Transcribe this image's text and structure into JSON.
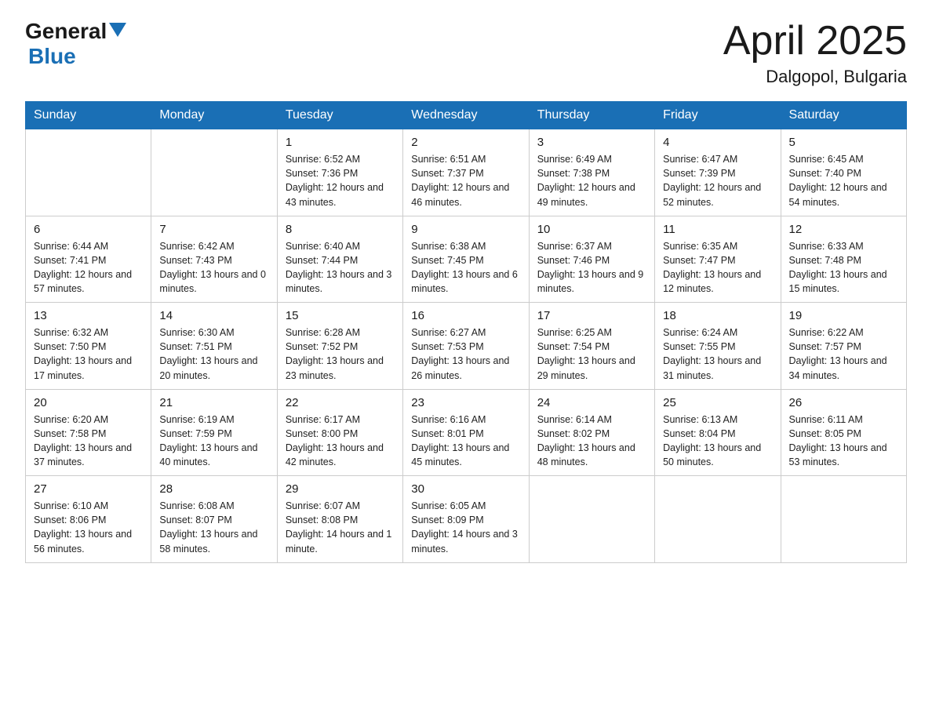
{
  "header": {
    "logo_general": "General",
    "logo_blue": "Blue",
    "title": "April 2025",
    "subtitle": "Dalgopol, Bulgaria"
  },
  "days_of_week": [
    "Sunday",
    "Monday",
    "Tuesday",
    "Wednesday",
    "Thursday",
    "Friday",
    "Saturday"
  ],
  "weeks": [
    [
      {
        "day": "",
        "sunrise": "",
        "sunset": "",
        "daylight": ""
      },
      {
        "day": "",
        "sunrise": "",
        "sunset": "",
        "daylight": ""
      },
      {
        "day": "1",
        "sunrise": "Sunrise: 6:52 AM",
        "sunset": "Sunset: 7:36 PM",
        "daylight": "Daylight: 12 hours and 43 minutes."
      },
      {
        "day": "2",
        "sunrise": "Sunrise: 6:51 AM",
        "sunset": "Sunset: 7:37 PM",
        "daylight": "Daylight: 12 hours and 46 minutes."
      },
      {
        "day": "3",
        "sunrise": "Sunrise: 6:49 AM",
        "sunset": "Sunset: 7:38 PM",
        "daylight": "Daylight: 12 hours and 49 minutes."
      },
      {
        "day": "4",
        "sunrise": "Sunrise: 6:47 AM",
        "sunset": "Sunset: 7:39 PM",
        "daylight": "Daylight: 12 hours and 52 minutes."
      },
      {
        "day": "5",
        "sunrise": "Sunrise: 6:45 AM",
        "sunset": "Sunset: 7:40 PM",
        "daylight": "Daylight: 12 hours and 54 minutes."
      }
    ],
    [
      {
        "day": "6",
        "sunrise": "Sunrise: 6:44 AM",
        "sunset": "Sunset: 7:41 PM",
        "daylight": "Daylight: 12 hours and 57 minutes."
      },
      {
        "day": "7",
        "sunrise": "Sunrise: 6:42 AM",
        "sunset": "Sunset: 7:43 PM",
        "daylight": "Daylight: 13 hours and 0 minutes."
      },
      {
        "day": "8",
        "sunrise": "Sunrise: 6:40 AM",
        "sunset": "Sunset: 7:44 PM",
        "daylight": "Daylight: 13 hours and 3 minutes."
      },
      {
        "day": "9",
        "sunrise": "Sunrise: 6:38 AM",
        "sunset": "Sunset: 7:45 PM",
        "daylight": "Daylight: 13 hours and 6 minutes."
      },
      {
        "day": "10",
        "sunrise": "Sunrise: 6:37 AM",
        "sunset": "Sunset: 7:46 PM",
        "daylight": "Daylight: 13 hours and 9 minutes."
      },
      {
        "day": "11",
        "sunrise": "Sunrise: 6:35 AM",
        "sunset": "Sunset: 7:47 PM",
        "daylight": "Daylight: 13 hours and 12 minutes."
      },
      {
        "day": "12",
        "sunrise": "Sunrise: 6:33 AM",
        "sunset": "Sunset: 7:48 PM",
        "daylight": "Daylight: 13 hours and 15 minutes."
      }
    ],
    [
      {
        "day": "13",
        "sunrise": "Sunrise: 6:32 AM",
        "sunset": "Sunset: 7:50 PM",
        "daylight": "Daylight: 13 hours and 17 minutes."
      },
      {
        "day": "14",
        "sunrise": "Sunrise: 6:30 AM",
        "sunset": "Sunset: 7:51 PM",
        "daylight": "Daylight: 13 hours and 20 minutes."
      },
      {
        "day": "15",
        "sunrise": "Sunrise: 6:28 AM",
        "sunset": "Sunset: 7:52 PM",
        "daylight": "Daylight: 13 hours and 23 minutes."
      },
      {
        "day": "16",
        "sunrise": "Sunrise: 6:27 AM",
        "sunset": "Sunset: 7:53 PM",
        "daylight": "Daylight: 13 hours and 26 minutes."
      },
      {
        "day": "17",
        "sunrise": "Sunrise: 6:25 AM",
        "sunset": "Sunset: 7:54 PM",
        "daylight": "Daylight: 13 hours and 29 minutes."
      },
      {
        "day": "18",
        "sunrise": "Sunrise: 6:24 AM",
        "sunset": "Sunset: 7:55 PM",
        "daylight": "Daylight: 13 hours and 31 minutes."
      },
      {
        "day": "19",
        "sunrise": "Sunrise: 6:22 AM",
        "sunset": "Sunset: 7:57 PM",
        "daylight": "Daylight: 13 hours and 34 minutes."
      }
    ],
    [
      {
        "day": "20",
        "sunrise": "Sunrise: 6:20 AM",
        "sunset": "Sunset: 7:58 PM",
        "daylight": "Daylight: 13 hours and 37 minutes."
      },
      {
        "day": "21",
        "sunrise": "Sunrise: 6:19 AM",
        "sunset": "Sunset: 7:59 PM",
        "daylight": "Daylight: 13 hours and 40 minutes."
      },
      {
        "day": "22",
        "sunrise": "Sunrise: 6:17 AM",
        "sunset": "Sunset: 8:00 PM",
        "daylight": "Daylight: 13 hours and 42 minutes."
      },
      {
        "day": "23",
        "sunrise": "Sunrise: 6:16 AM",
        "sunset": "Sunset: 8:01 PM",
        "daylight": "Daylight: 13 hours and 45 minutes."
      },
      {
        "day": "24",
        "sunrise": "Sunrise: 6:14 AM",
        "sunset": "Sunset: 8:02 PM",
        "daylight": "Daylight: 13 hours and 48 minutes."
      },
      {
        "day": "25",
        "sunrise": "Sunrise: 6:13 AM",
        "sunset": "Sunset: 8:04 PM",
        "daylight": "Daylight: 13 hours and 50 minutes."
      },
      {
        "day": "26",
        "sunrise": "Sunrise: 6:11 AM",
        "sunset": "Sunset: 8:05 PM",
        "daylight": "Daylight: 13 hours and 53 minutes."
      }
    ],
    [
      {
        "day": "27",
        "sunrise": "Sunrise: 6:10 AM",
        "sunset": "Sunset: 8:06 PM",
        "daylight": "Daylight: 13 hours and 56 minutes."
      },
      {
        "day": "28",
        "sunrise": "Sunrise: 6:08 AM",
        "sunset": "Sunset: 8:07 PM",
        "daylight": "Daylight: 13 hours and 58 minutes."
      },
      {
        "day": "29",
        "sunrise": "Sunrise: 6:07 AM",
        "sunset": "Sunset: 8:08 PM",
        "daylight": "Daylight: 14 hours and 1 minute."
      },
      {
        "day": "30",
        "sunrise": "Sunrise: 6:05 AM",
        "sunset": "Sunset: 8:09 PM",
        "daylight": "Daylight: 14 hours and 3 minutes."
      },
      {
        "day": "",
        "sunrise": "",
        "sunset": "",
        "daylight": ""
      },
      {
        "day": "",
        "sunrise": "",
        "sunset": "",
        "daylight": ""
      },
      {
        "day": "",
        "sunrise": "",
        "sunset": "",
        "daylight": ""
      }
    ]
  ]
}
